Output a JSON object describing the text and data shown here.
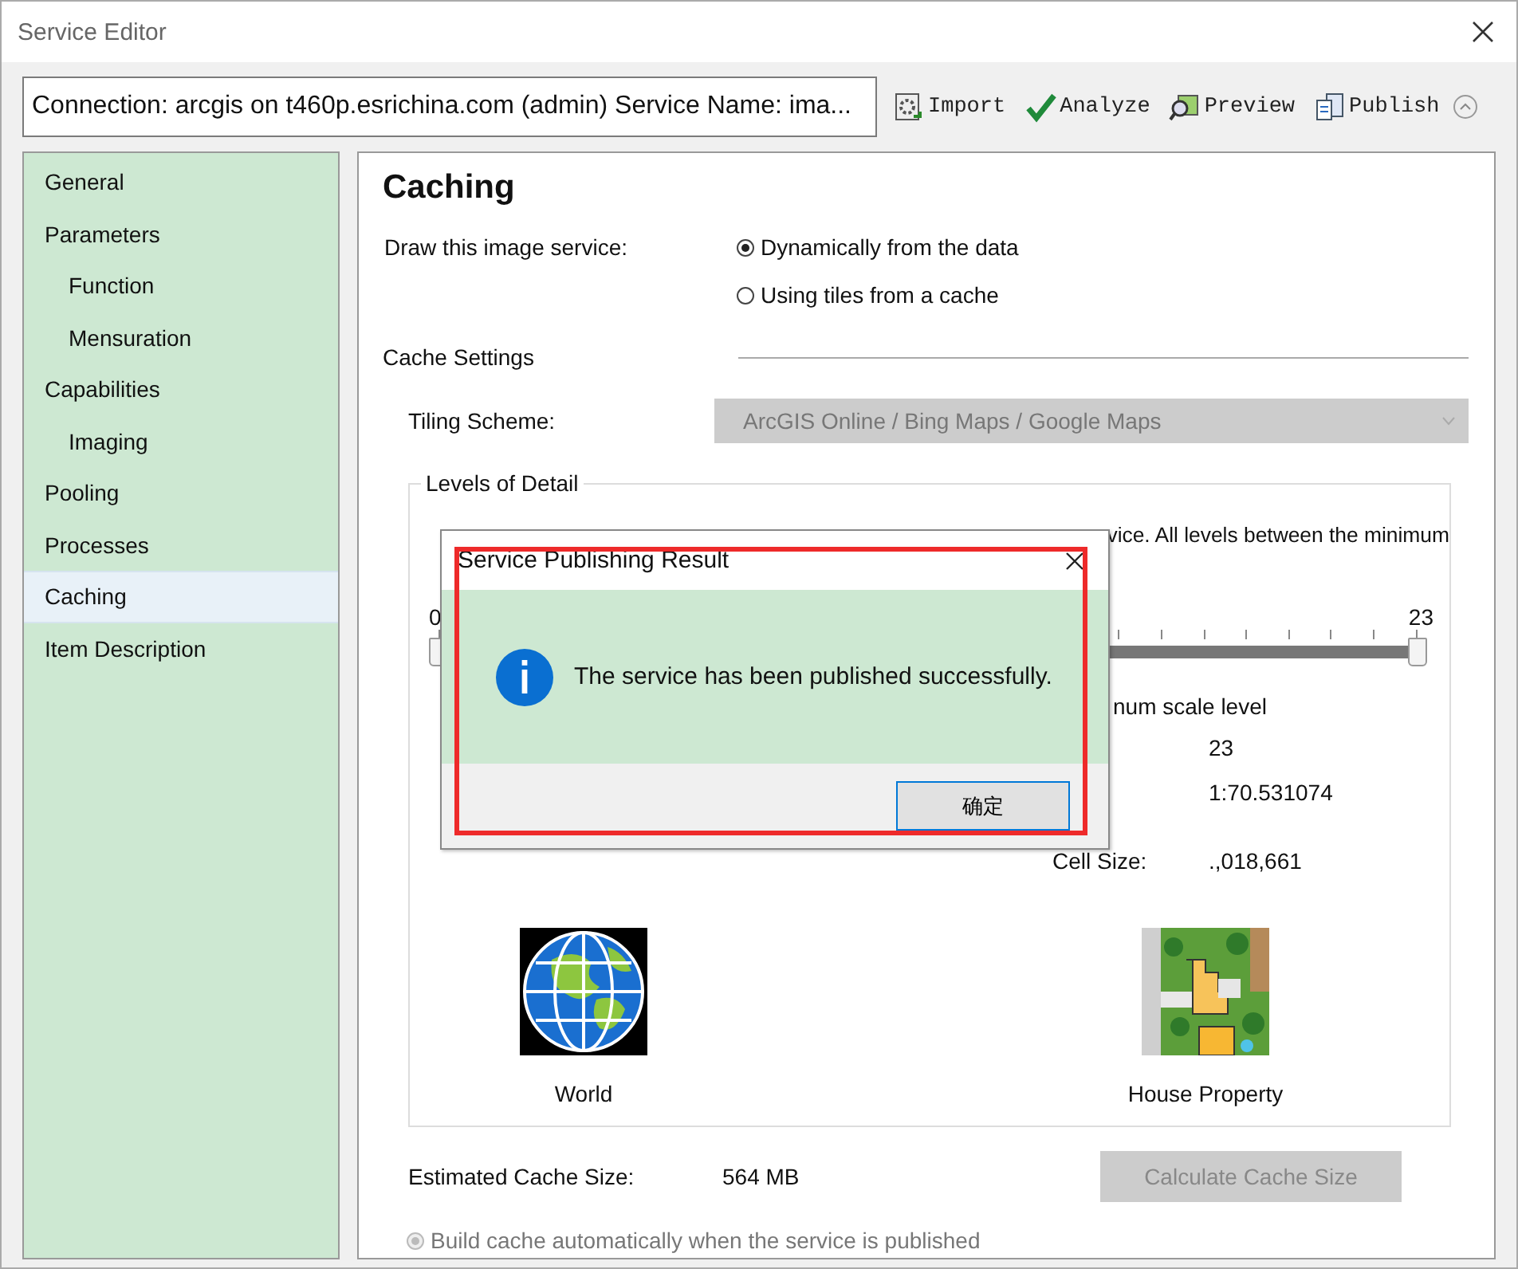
{
  "window": {
    "title": "Service Editor"
  },
  "toolbar": {
    "connection": "Connection: arcgis on t460p.esrichina.com (admin)   Service Name: ima...",
    "buttons": [
      {
        "kind": "import",
        "label": "Import"
      },
      {
        "kind": "analyze",
        "label": "Analyze"
      },
      {
        "kind": "preview",
        "label": "Preview"
      },
      {
        "kind": "publish",
        "label": "Publish"
      }
    ]
  },
  "sidebar": {
    "items": [
      {
        "label": "General",
        "selected": false
      },
      {
        "label": "Parameters",
        "selected": false,
        "children": [
          {
            "label": "Function",
            "selected": false
          },
          {
            "label": "Mensuration",
            "selected": false
          }
        ]
      },
      {
        "label": "Capabilities",
        "selected": false,
        "children": [
          {
            "label": "Imaging",
            "selected": false
          }
        ]
      },
      {
        "label": "Pooling",
        "selected": false
      },
      {
        "label": "Processes",
        "selected": false
      },
      {
        "label": "Caching",
        "selected": true
      },
      {
        "label": "Item Description",
        "selected": false
      }
    ]
  },
  "panel": {
    "title": "Caching",
    "draw_label": "Draw this image service:",
    "draw_options": [
      {
        "label": "Dynamically from the data",
        "selected": true
      },
      {
        "label": "Using tiles from a cache",
        "selected": false
      }
    ],
    "cache_settings": "Cache Settings",
    "tiling_label": "Tiling Scheme:",
    "tiling_value": "ArcGIS Online / Bing Maps / Google Maps",
    "levels": {
      "title": "Levels of Detail",
      "note": "vice. All levels between the minimum",
      "slider": {
        "min_label": "0",
        "max_label": "23",
        "min_thumb": {
          "level": 0
        },
        "max_thumb": {
          "level": 1
        }
      },
      "max_heading": "num scale level",
      "max_level": "23",
      "max_scale": "1:70.531074",
      "cell_label": "Cell Size:",
      "cell_value": ".,018,661",
      "examples": [
        {
          "kind": "world",
          "label": "World"
        },
        {
          "kind": "house",
          "label": "House Property"
        }
      ]
    },
    "estimate_label": "Estimated Cache Size:",
    "estimate_value": "564 MB",
    "calculate_button": "Calculate Cache Size",
    "build_option": {
      "label": "Build cache automatically when the service is published",
      "selected": true,
      "disabled": true
    }
  },
  "dialog": {
    "title": "Service Publishing Result",
    "message": "The service has been published successfully.",
    "ok": "确定",
    "highlighted": true
  }
}
